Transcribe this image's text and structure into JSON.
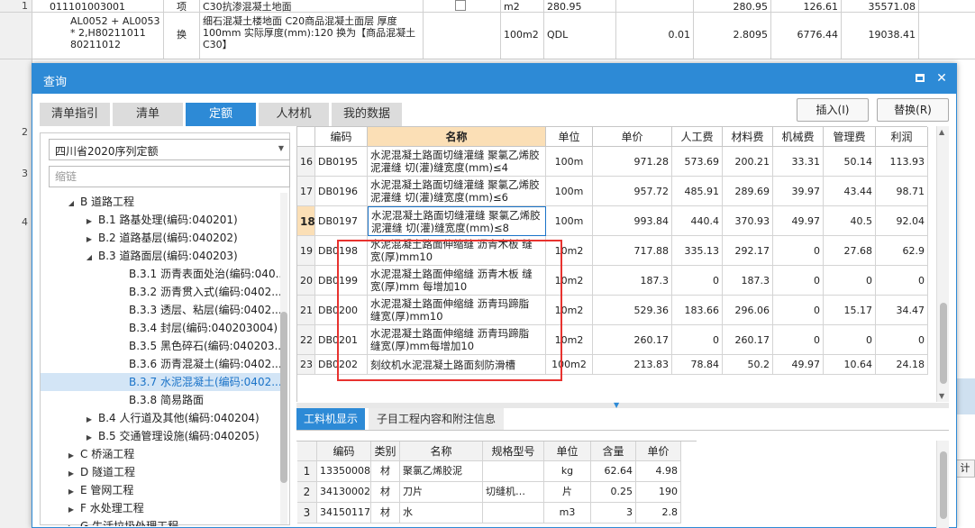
{
  "background": {
    "rows": [
      {
        "no": "1",
        "code": "011101003001",
        "type": "项",
        "desc": "C30抗渗混凝土地面",
        "unit": "m2",
        "qty": "280.95",
        "v1": "280.95",
        "v2": "126.61",
        "v3": "35571.08"
      },
      {
        "no": "",
        "code": "AL0052 + AL0053 * 2,H80211011 80211012",
        "type": "换",
        "desc": "细石混凝土楼地面 C20商品混凝土面层 厚度100mm 实际厚度(mm):120 换为【商品混凝土 C30】",
        "unit": "100m2",
        "qty": "QDL",
        "v0": "0.01",
        "v1": "2.8095",
        "v2": "6776.44",
        "v3": "19038.41"
      }
    ],
    "gutter_numbers": [
      "2",
      "3",
      "4"
    ],
    "right_label": "计算"
  },
  "dialog": {
    "title": "查询",
    "maximize_symbol": "□",
    "close_symbol": "✕",
    "tabs": [
      "清单指引",
      "清单",
      "定额",
      "人材机",
      "我的数据"
    ],
    "active_tab": 2,
    "insert_button": "插入(I)",
    "replace_button": "替换(R)"
  },
  "left_panel": {
    "select_value": "四川省2020序列定额",
    "filter_placeholder": "缩链",
    "tree": [
      {
        "label": "B 道路工程",
        "level": 1,
        "toggle": "▲"
      },
      {
        "label": "B.1 路基处理(编码:040201)",
        "level": 2,
        "toggle": "▶"
      },
      {
        "label": "B.2 道路基层(编码:040202)",
        "level": 2,
        "toggle": "▶"
      },
      {
        "label": "B.3 道路面层(编码:040203)",
        "level": 2,
        "toggle": "▲"
      },
      {
        "label": "B.3.1 沥青表面处治(编码:040...",
        "level": 3,
        "toggle": ""
      },
      {
        "label": "B.3.2 沥青贯入式(编码:0402...",
        "level": 3,
        "toggle": ""
      },
      {
        "label": "B.3.3 透层、粘层(编码:0402...",
        "level": 3,
        "toggle": ""
      },
      {
        "label": "B.3.4 封层(编码:040203004)",
        "level": 3,
        "toggle": ""
      },
      {
        "label": "B.3.5 黑色碎石(编码:040203...",
        "level": 3,
        "toggle": ""
      },
      {
        "label": "B.3.6 沥青混凝土(编码:0402...",
        "level": 3,
        "toggle": ""
      },
      {
        "label": "B.3.7 水泥混凝土(编码:0402...",
        "level": 3,
        "toggle": "",
        "selected": true
      },
      {
        "label": "B.3.8 简易路面",
        "level": 3,
        "toggle": ""
      },
      {
        "label": "B.4 人行道及其他(编码:040204)",
        "level": 2,
        "toggle": "▶"
      },
      {
        "label": "B.5 交通管理设施(编码:040205)",
        "level": 2,
        "toggle": "▶"
      },
      {
        "label": "C 桥涵工程",
        "level": 1,
        "toggle": "▶"
      },
      {
        "label": "D 隧道工程",
        "level": 1,
        "toggle": "▶"
      },
      {
        "label": "E 管网工程",
        "level": 1,
        "toggle": "▶"
      },
      {
        "label": "F 水处理工程",
        "level": 1,
        "toggle": "▶"
      },
      {
        "label": "G 生活垃圾处理工程",
        "level": 1,
        "toggle": "▶"
      }
    ]
  },
  "main_grid": {
    "headers": [
      "",
      "编码",
      "名称",
      "单位",
      "单价",
      "人工费",
      "材料费",
      "机械费",
      "管理费",
      "利润"
    ],
    "rows": [
      {
        "no": "16",
        "code": "DB0195",
        "name": "水泥混凝土路面切缝灌缝 聚氯乙烯胶泥灌缝 切(灌)缝宽度(mm)≤4",
        "unit": "100m",
        "price": "971.28",
        "labor": "573.69",
        "material": "200.21",
        "machine": "33.31",
        "mgmt": "50.14",
        "profit": "113.93"
      },
      {
        "no": "17",
        "code": "DB0196",
        "name": "水泥混凝土路面切缝灌缝 聚氯乙烯胶泥灌缝 切(灌)缝宽度(mm)≤6",
        "unit": "100m",
        "price": "957.72",
        "labor": "485.91",
        "material": "289.69",
        "machine": "39.97",
        "mgmt": "43.44",
        "profit": "98.71"
      },
      {
        "no": "18",
        "code": "DB0197",
        "name": "水泥混凝土路面切缝灌缝 聚氯乙烯胶泥灌缝 切(灌)缝宽度(mm)≤8",
        "unit": "100m",
        "price": "993.84",
        "labor": "440.4",
        "material": "370.93",
        "machine": "49.97",
        "mgmt": "40.5",
        "profit": "92.04",
        "active": true
      },
      {
        "no": "19",
        "code": "DB0198",
        "name": "水泥混凝土路面伸缩缝 沥青木板 缝宽(厚)mm10",
        "unit": "10m2",
        "price": "717.88",
        "labor": "335.13",
        "material": "292.17",
        "machine": "0",
        "mgmt": "27.68",
        "profit": "62.9"
      },
      {
        "no": "20",
        "code": "DB0199",
        "name": "水泥混凝土路面伸缩缝 沥青木板 缝宽(厚)mm 每增加10",
        "unit": "10m2",
        "price": "187.3",
        "labor": "0",
        "material": "187.3",
        "machine": "0",
        "mgmt": "0",
        "profit": "0"
      },
      {
        "no": "21",
        "code": "DB0200",
        "name": "水泥混凝土路面伸缩缝 沥青玛蹄脂 缝宽(厚)mm10",
        "unit": "10m2",
        "price": "529.36",
        "labor": "183.66",
        "material": "296.06",
        "machine": "0",
        "mgmt": "15.17",
        "profit": "34.47"
      },
      {
        "no": "22",
        "code": "DB0201",
        "name": "水泥混凝土路面伸缩缝 沥青玛蹄脂 缝宽(厚)mm每增加10",
        "unit": "10m2",
        "price": "260.17",
        "labor": "0",
        "material": "260.17",
        "machine": "0",
        "mgmt": "0",
        "profit": "0"
      },
      {
        "no": "23",
        "code": "DB0202",
        "name": "刻纹机水泥混凝土路面刻防滑槽",
        "unit": "100m2",
        "price": "213.83",
        "labor": "78.84",
        "material": "50.2",
        "machine": "49.97",
        "mgmt": "10.64",
        "profit": "24.18"
      }
    ]
  },
  "bottom": {
    "tabs": [
      "工料机显示",
      "子目工程内容和附注信息"
    ],
    "headers": [
      "",
      "编码",
      "类别",
      "名称",
      "规格型号",
      "单位",
      "含量",
      "单价"
    ],
    "rows": [
      {
        "no": "1",
        "code": "13350008",
        "cat": "材",
        "name": "聚氯乙烯胶泥",
        "spec": "",
        "unit": "kg",
        "qty": "62.64",
        "price": "4.98"
      },
      {
        "no": "2",
        "code": "34130002",
        "cat": "材",
        "name": "刀片",
        "spec": "切缝机…",
        "unit": "片",
        "qty": "0.25",
        "price": "190"
      },
      {
        "no": "3",
        "code": "34150117",
        "cat": "材",
        "name": "水",
        "spec": "",
        "unit": "m3",
        "qty": "3",
        "price": "2.8"
      }
    ]
  },
  "colors": {
    "accent": "#2d8ad6",
    "highlight": "#e8322f",
    "header_active": "#fbdfb6"
  }
}
